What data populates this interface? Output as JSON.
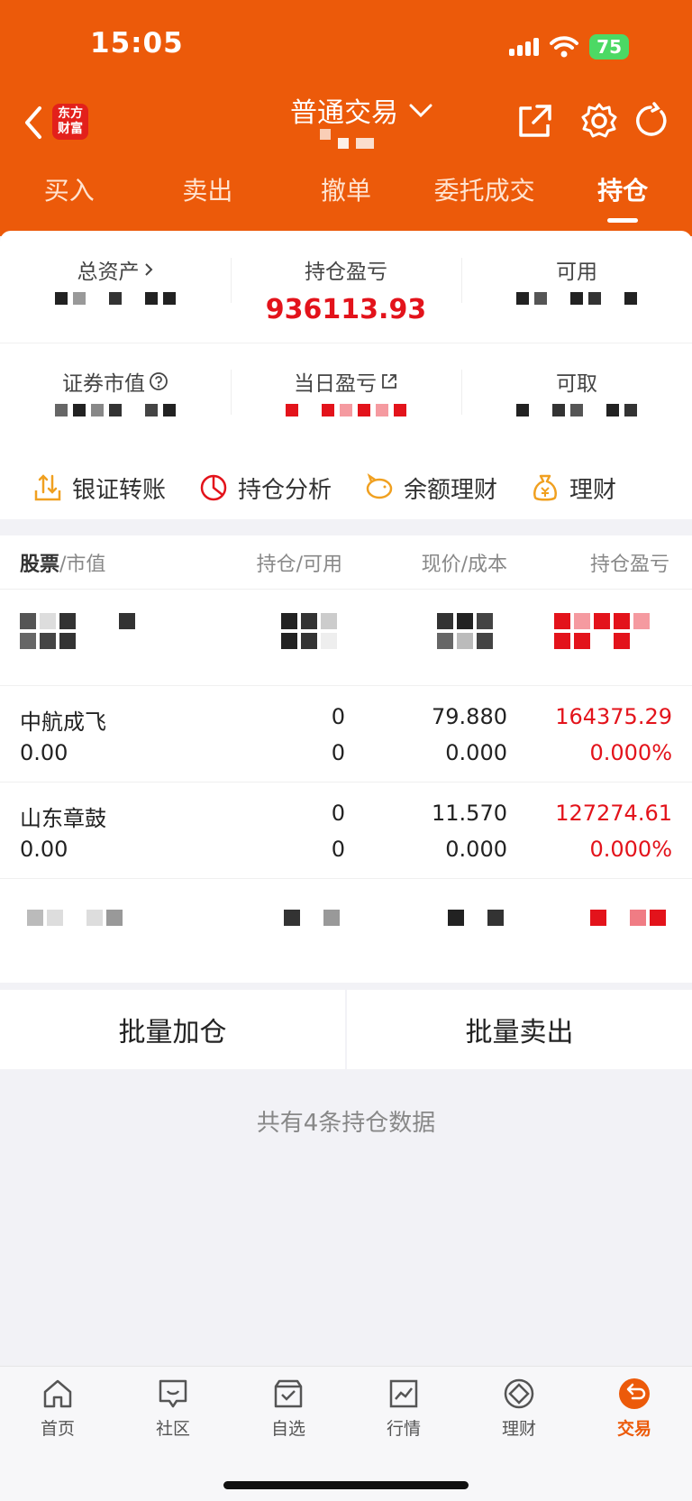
{
  "status": {
    "time": "15:05",
    "battery": "75"
  },
  "header": {
    "brand_logo": "东方\n财富",
    "title": "普通交易"
  },
  "tabs": [
    {
      "label": "买入"
    },
    {
      "label": "卖出"
    },
    {
      "label": "撤单"
    },
    {
      "label": "委托成交"
    },
    {
      "label": "持仓",
      "active": true
    }
  ],
  "summary": {
    "total_assets_label": "总资产",
    "position_pnl_label": "持仓盈亏",
    "position_pnl_value": "936113.93",
    "available_label": "可用",
    "market_value_label": "证券市值",
    "daily_pnl_label": "当日盈亏",
    "withdrawable_label": "可取"
  },
  "quick_actions": [
    {
      "label": "银证转账",
      "icon": "upload-transfer-icon"
    },
    {
      "label": "持仓分析",
      "icon": "pie-chart-icon"
    },
    {
      "label": "余额理财",
      "icon": "piggy-bank-icon"
    },
    {
      "label": "理财",
      "icon": "money-bag-icon"
    }
  ],
  "table": {
    "headers": {
      "stock": "股票",
      "market_value": "/市值",
      "position": "持仓/可用",
      "price": "现价/成本",
      "pnl": "持仓盈亏"
    },
    "rows": [
      {
        "name": "中航成飞",
        "market_value": "0.00",
        "position": "0",
        "available": "0",
        "price": "79.880",
        "cost": "0.000",
        "pnl": "164375.29",
        "pnl_pct": "0.000%"
      },
      {
        "name": "山东章鼓",
        "market_value": "0.00",
        "position": "0",
        "available": "0",
        "price": "11.570",
        "cost": "0.000",
        "pnl": "127274.61",
        "pnl_pct": "0.000%"
      }
    ]
  },
  "actions": {
    "batch_add": "批量加仓",
    "batch_sell": "批量卖出"
  },
  "footer_note": "共有4条持仓数据",
  "bottom_nav": [
    {
      "label": "首页",
      "icon": "home-icon"
    },
    {
      "label": "社区",
      "icon": "community-icon"
    },
    {
      "label": "自选",
      "icon": "watchlist-icon"
    },
    {
      "label": "行情",
      "icon": "market-chart-icon"
    },
    {
      "label": "理财",
      "icon": "wealth-icon"
    },
    {
      "label": "交易",
      "icon": "trade-icon",
      "active": true
    }
  ],
  "colors": {
    "brand": "#ec5a0a",
    "gain": "#e3131b",
    "logo": "#e3201b"
  }
}
